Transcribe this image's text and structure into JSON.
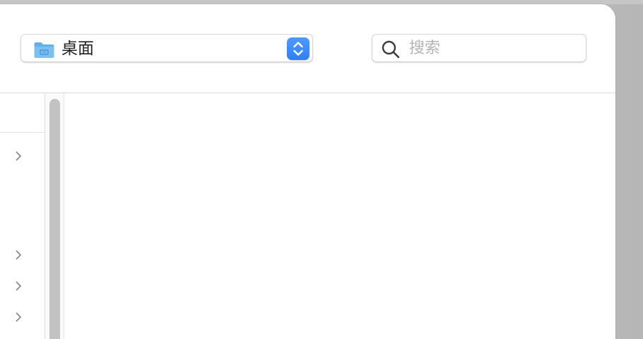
{
  "toolbar": {
    "location": {
      "label": "桌面",
      "icon": "folder-icon"
    },
    "search": {
      "placeholder": "搜索",
      "value": "",
      "icon": "magnifier-icon"
    }
  },
  "sidebar": {
    "rows": [
      {
        "icon": "chevron-right-icon"
      },
      {
        "icon": "chevron-right-icon"
      },
      {
        "icon": "chevron-right-icon"
      },
      {
        "icon": "chevron-right-icon"
      }
    ]
  },
  "colors": {
    "accent": "#3a8cff",
    "folder": "#5aa9e6",
    "window_bg": "#ffffff",
    "desktop_bg": "#c0c0c0"
  }
}
